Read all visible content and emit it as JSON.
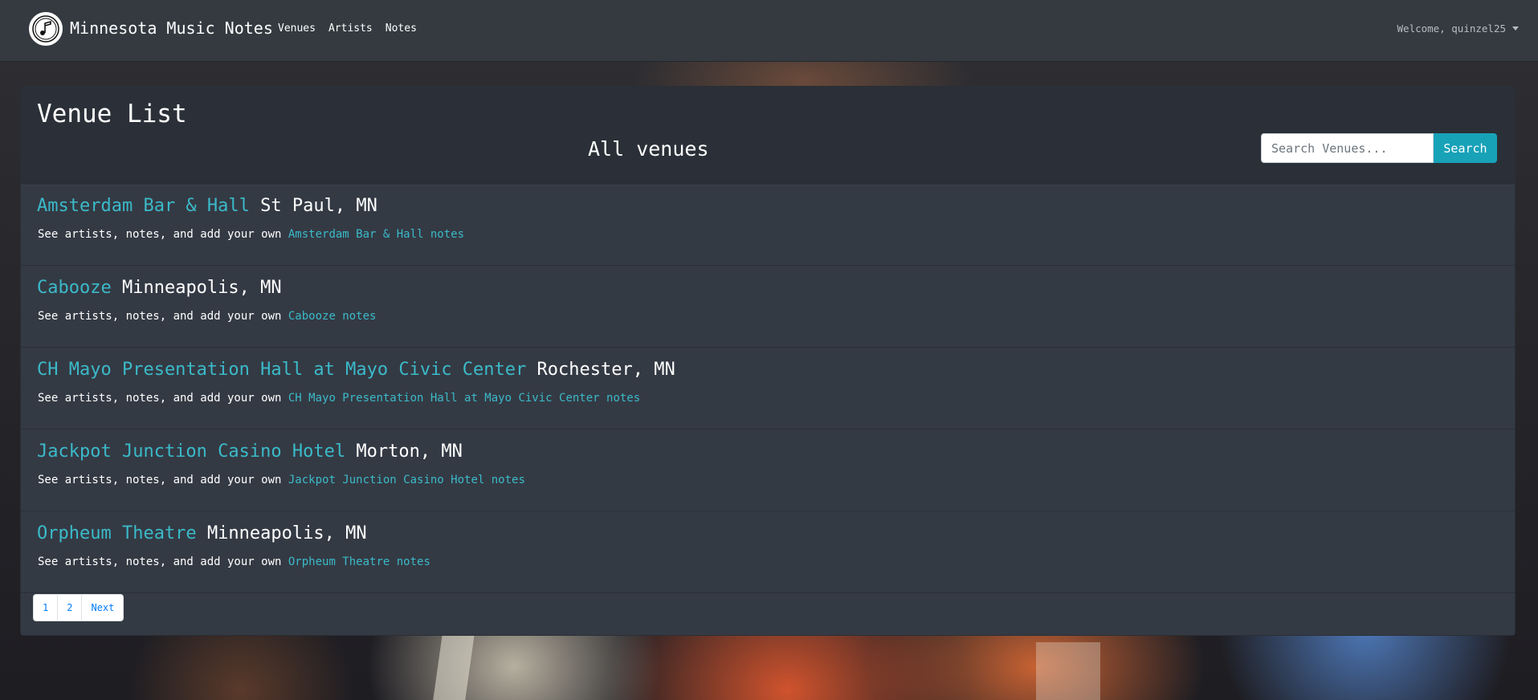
{
  "navbar": {
    "brand": "Minnesota Music Notes",
    "links": [
      "Venues",
      "Artists",
      "Notes"
    ],
    "welcome": "Welcome, quinzel25"
  },
  "page": {
    "title": "Venue List",
    "subtitle": "All venues"
  },
  "search": {
    "placeholder": "Search Venues...",
    "button": "Search"
  },
  "venues": [
    {
      "name": "Amsterdam Bar & Hall",
      "city": "St Paul, MN",
      "desc_prefix": "See artists, notes, and add your own",
      "link": "Amsterdam Bar & Hall notes"
    },
    {
      "name": "Cabooze",
      "city": "Minneapolis, MN",
      "desc_prefix": "See artists, notes, and add your own",
      "link": "Cabooze notes"
    },
    {
      "name": "CH Mayo Presentation Hall at Mayo Civic Center",
      "city": "Rochester, MN",
      "desc_prefix": "See artists, notes, and add your own",
      "link": "CH Mayo Presentation Hall at Mayo Civic Center notes"
    },
    {
      "name": "Jackpot Junction Casino Hotel",
      "city": "Morton, MN",
      "desc_prefix": "See artists, notes, and add your own",
      "link": "Jackpot Junction Casino Hotel notes"
    },
    {
      "name": "Orpheum Theatre",
      "city": "Minneapolis, MN",
      "desc_prefix": "See artists, notes, and add your own",
      "link": "Orpheum Theatre notes"
    }
  ],
  "pagination": [
    "1",
    "2",
    "Next"
  ],
  "colors": {
    "navbar": "#343a40",
    "link": "#3bbac9",
    "search_button": "#17a2b8",
    "card": "#343a44"
  },
  "icons": {
    "logo": "music-note-icon",
    "dropdown": "caret-down-icon"
  }
}
